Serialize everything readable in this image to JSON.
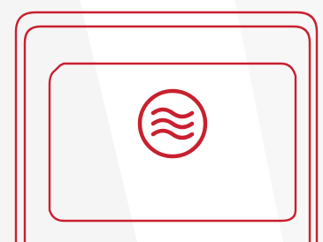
{
  "colors": {
    "background": "#ffffff",
    "light_band": "#f5f5f5",
    "outline": "#c8202f"
  },
  "icons": {
    "main": "waves-icon"
  }
}
